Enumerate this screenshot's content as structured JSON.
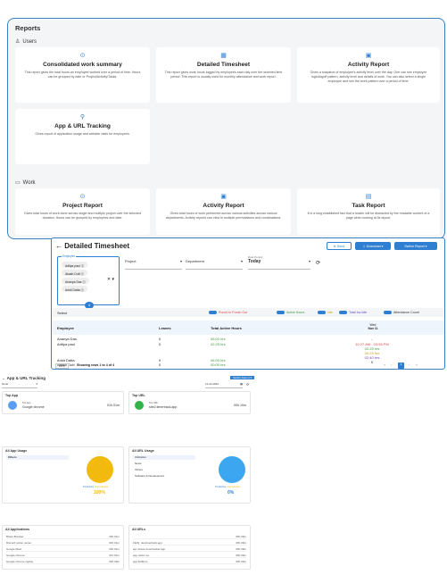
{
  "reports": {
    "title": "Reports",
    "users_section": "Users",
    "work_section": "Work",
    "users_cards": [
      {
        "icon": "⊙",
        "title": "Consolidated work summary",
        "desc": "This report gives the total hours an employee worked over a period of time. Hours can be grouped by date or Project/Activity/Tasks."
      },
      {
        "icon": "▦",
        "title": "Detailed Timesheet",
        "desc": "This report gives work hours logged by employees each day over the selected time period. This report is usually used for monthly attendance and work report."
      },
      {
        "icon": "▣",
        "title": "Activity Report",
        "desc": "Gives a snapshot of employee's activity level over the day. One can see employee login/logoff pattern, activity level and details of work. You can also select a single employee and see the work pattern over a period of time."
      },
      {
        "icon": "⚲",
        "title": "App & URL Tracking",
        "desc": "Gives report of application usage and website visits for employees."
      }
    ],
    "work_cards": [
      {
        "icon": "⊙",
        "title": "Project Report",
        "desc": "Gives total hours of work done across single and multiple project over the selected duration. Hours can be grouped by employees and date."
      },
      {
        "icon": "▣",
        "title": "Activity Report",
        "desc": "Gives total hours of work performed across various activities across various departments. Activity reports can view in multiple permutations and combinations."
      },
      {
        "icon": "▤",
        "title": "Task Report",
        "desc": "It is a long established fact that a reader will be distracted by the readable content of a page when looking at its layout."
      }
    ]
  },
  "timesheet": {
    "title": "Detailed Timesheet",
    "send": "Send",
    "download": "Download",
    "switch": "Switch Report",
    "employee_label": "Employee",
    "employees_selected": [
      "Aditya paul",
      "Akash Dutt",
      "Ananya Das",
      "Ankit Datta"
    ],
    "selected_count": "4",
    "project": "Project",
    "department": "Department",
    "date_label": "Date Period",
    "date_value": "Today",
    "select_label": "Select",
    "toggles": [
      {
        "label": "Punch In Punch Out",
        "color": "#d94b4b"
      },
      {
        "label": "Active Hours",
        "color": "#3a9a3a"
      },
      {
        "label": "Idle",
        "color": "#d1a017"
      },
      {
        "label": "Total Inc.Idle",
        "color": "#6a3fb5"
      },
      {
        "label": "Attendance Count",
        "color": "#333333"
      }
    ],
    "columns": [
      "Employee",
      "Leaves",
      "Total Active Hours"
    ],
    "date_col": {
      "day": "Wed",
      "date": "Nov 11"
    },
    "rows": [
      {
        "name": "Ananya Das",
        "leaves": "0",
        "hours": "06:00 hrs"
      },
      {
        "name": "Aditya paul",
        "leaves": "0",
        "hours": "02:25 hrs"
      },
      {
        "name": "Ankit Datta",
        "leaves": "0",
        "hours": "06:00 hrs"
      },
      {
        "name": "Akash Dutt",
        "leaves": "0",
        "hours": "00:00 hrs"
      }
    ],
    "detail": {
      "punch": "10:27 AM - 03:55 PM",
      "active": "02:25 hrs",
      "idle": "00:25 hrs",
      "total": "02:40 hrs",
      "count": "0"
    },
    "page_size": "20",
    "showing": "Showing rows 1 to 4 of 4",
    "page": "1"
  },
  "apptrack": {
    "title": "App & URL Tracking",
    "filter": "None",
    "date": "11-11-2024",
    "switch": "Switch Report",
    "top_app": "Top App",
    "top_app_name": "Google chrome",
    "top_app_sub": "Top App",
    "top_app_time": "01h 01m",
    "top_url": "Top URL",
    "top_url_name": "site2.timertrack.app",
    "top_url_sub": "Top URL",
    "top_url_time": "00h 10m",
    "all_app_usage": "All App Usage",
    "app_usage_row": "Others",
    "app_pct": "100%",
    "all_url_usage": "All URL Usage",
    "url_usage_rows": [
      "Utilization",
      "News",
      "Others",
      "Software & Development"
    ],
    "url_pct": "0%",
    "legend_prod": "Productive",
    "legend_unprod": "Unproductive",
    "all_apps": "All Applications",
    "apps": [
      "Brave Browser",
      "Discord notion owner",
      "Google Meet",
      "Google chrome",
      "Google chrome nightly"
    ],
    "app_times": [
      "00h 01m",
      "00h 01m",
      "00h 01m",
      "01h 01m",
      "00h 00m"
    ],
    "all_urls": "All URLs",
    "urls": [
      "",
      "Fluffy: devtimertrack.app",
      "api.minute.timertracker.app",
      "app.notion.so",
      "app.fluffify.io"
    ],
    "url_times": [
      "00h 00m",
      "00h 00m",
      "00h 00m",
      "00h 00m",
      "00h 00m"
    ]
  }
}
